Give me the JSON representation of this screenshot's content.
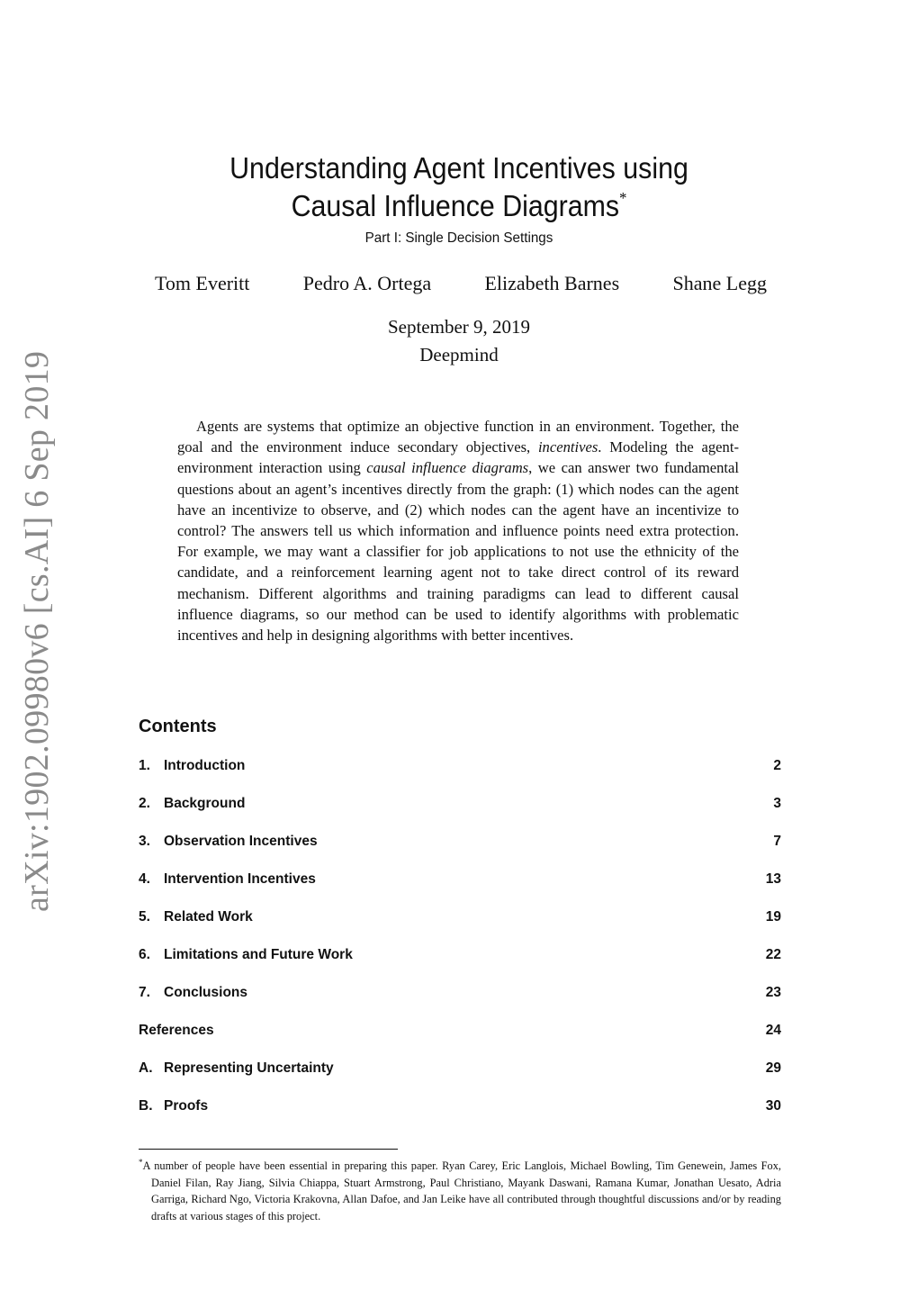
{
  "arxiv_stamp": "arXiv:1902.09980v6  [cs.AI]  6 Sep 2019",
  "title": {
    "line1": "Understanding Agent Incentives using",
    "line2": "Causal Influence Diagrams",
    "footnote_marker": "*",
    "subtitle": "Part I: Single Decision Settings"
  },
  "authors": [
    "Tom Everitt",
    "Pedro A. Ortega",
    "Elizabeth Barnes",
    "Shane Legg"
  ],
  "date": "September 9, 2019",
  "affiliation": "Deepmind",
  "abstract": {
    "part1": "Agents are systems that optimize an objective function in an environment. Together, the goal and the environment induce secondary objectives, ",
    "em1": "incentives",
    "part2": ". Modeling the agent-environment interaction using ",
    "em2": "causal influence diagrams",
    "part3": ", we can answer two fundamental questions about an agent’s incentives directly from the graph: (1) which nodes can the agent have an incentivize to observe, and (2) which nodes can the agent have an incentivize to control? The answers tell us which information and influence points need extra protection. For example, we may want a classifier for job applications to not use the ethnicity of the candidate, and a reinforcement learning agent not to take direct control of its reward mechanism. Different algorithms and training paradigms can lead to different causal influence diagrams, so our method can be used to identify algorithms with problematic incentives and help in designing algorithms with better incentives."
  },
  "contents": {
    "heading": "Contents",
    "entries": [
      {
        "num": "1.",
        "title": "Introduction",
        "page": "2"
      },
      {
        "num": "2.",
        "title": "Background",
        "page": "3"
      },
      {
        "num": "3.",
        "title": "Observation Incentives",
        "page": "7"
      },
      {
        "num": "4.",
        "title": "Intervention Incentives",
        "page": "13"
      },
      {
        "num": "5.",
        "title": "Related Work",
        "page": "19"
      },
      {
        "num": "6.",
        "title": "Limitations and Future Work",
        "page": "22"
      },
      {
        "num": "7.",
        "title": "Conclusions",
        "page": "23"
      },
      {
        "num": "",
        "title": "References",
        "page": "24"
      },
      {
        "num": "A.",
        "title": "Representing Uncertainty",
        "page": "29"
      },
      {
        "num": "B.",
        "title": "Proofs",
        "page": "30"
      }
    ]
  },
  "footnote": {
    "marker": "*",
    "text": "A number of people have been essential in preparing this paper. Ryan Carey, Eric Langlois, Michael Bowling, Tim Genewein, James Fox, Daniel Filan, Ray Jiang, Silvia Chiappa, Stuart Armstrong, Paul Christiano, Mayank Daswani, Ramana Kumar, Jonathan Uesato, Adria Garriga, Richard Ngo, Victoria Krakovna, Allan Dafoe, and Jan Leike have all contributed through thoughtful discussions and/or by reading drafts at various stages of this project."
  }
}
